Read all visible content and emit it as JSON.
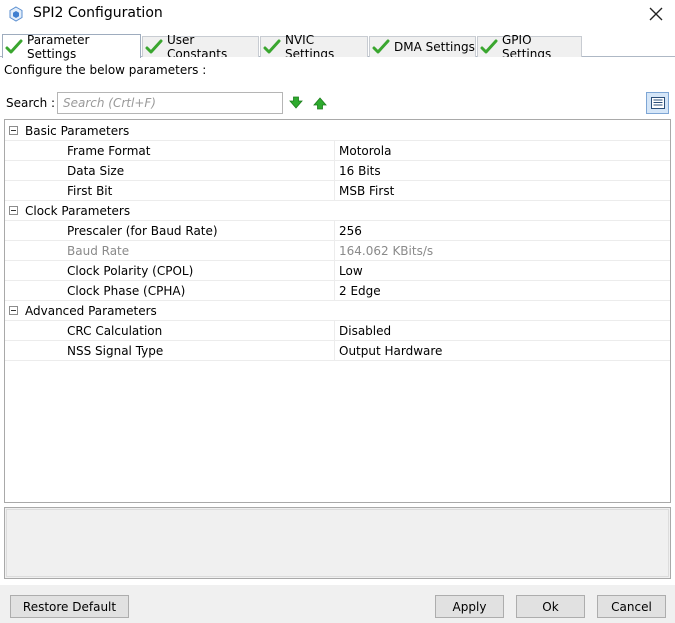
{
  "window": {
    "title": "SPI2 Configuration",
    "icon": "app-cube-icon",
    "close_icon": "close-icon"
  },
  "tabs": [
    {
      "label": "Parameter Settings",
      "icon": "checkmark-icon",
      "active": true
    },
    {
      "label": "User Constants",
      "icon": "checkmark-icon",
      "active": false
    },
    {
      "label": "NVIC Settings",
      "icon": "checkmark-icon",
      "active": false
    },
    {
      "label": "DMA Settings",
      "icon": "checkmark-icon",
      "active": false
    },
    {
      "label": "GPIO Settings",
      "icon": "checkmark-icon",
      "active": false
    }
  ],
  "main": {
    "description": "Configure the below parameters :",
    "search": {
      "label": "Search :",
      "placeholder": "Search (Crtl+F)",
      "value": "",
      "next_icon": "arrow-down-icon",
      "prev_icon": "arrow-up-icon",
      "view_icon": "list-view-icon"
    }
  },
  "groups": [
    {
      "label": "Basic Parameters",
      "params": [
        {
          "name": "Frame Format",
          "value": "Motorola"
        },
        {
          "name": "Data Size",
          "value": "16 Bits"
        },
        {
          "name": "First Bit",
          "value": "MSB First"
        }
      ]
    },
    {
      "label": "Clock Parameters",
      "params": [
        {
          "name": "Prescaler (for Baud Rate)",
          "value": "256"
        },
        {
          "name": "Baud Rate",
          "value": "164.062 KBits/s",
          "disabled": true
        },
        {
          "name": "Clock Polarity (CPOL)",
          "value": "Low"
        },
        {
          "name": "Clock Phase (CPHA)",
          "value": "2 Edge"
        }
      ]
    },
    {
      "label": "Advanced Parameters",
      "params": [
        {
          "name": "CRC Calculation",
          "value": "Disabled"
        },
        {
          "name": "NSS Signal Type",
          "value": "Output Hardware"
        }
      ]
    }
  ],
  "footer": {
    "restore_label": "Restore Default",
    "apply_label": "Apply",
    "ok_label": "Ok",
    "cancel_label": "Cancel"
  },
  "colors": {
    "check_green": "#3aa62f",
    "arrow_green": "#2eaa2e",
    "accent_blue": "#7ea6d5",
    "disabled_text": "#8a8a8a"
  }
}
